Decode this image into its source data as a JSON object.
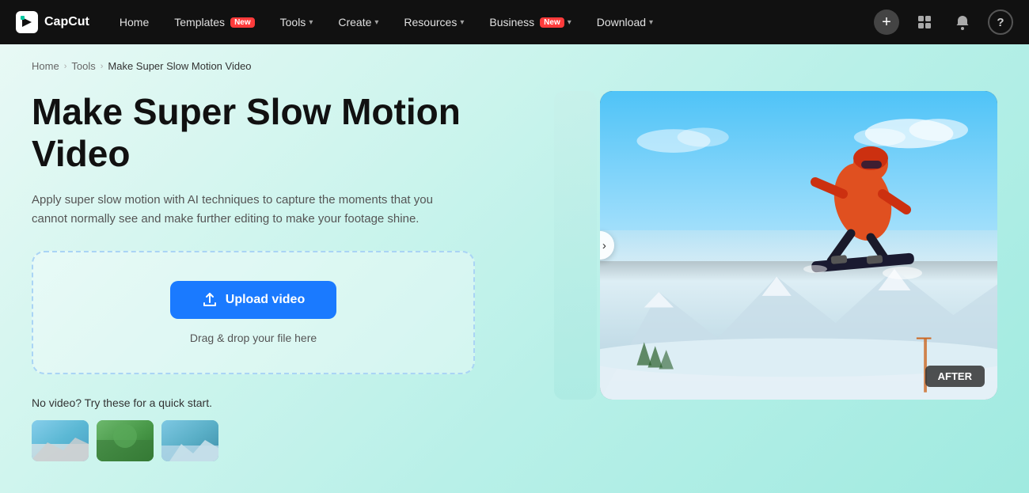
{
  "nav": {
    "logo_text": "CapCut",
    "home_label": "Home",
    "templates_label": "Templates",
    "templates_badge": "New",
    "tools_label": "Tools",
    "create_label": "Create",
    "resources_label": "Resources",
    "business_label": "Business",
    "business_badge": "New",
    "download_label": "Download",
    "plus_icon": "+",
    "dashboard_icon": "⊞",
    "bell_icon": "🔔",
    "help_icon": "?"
  },
  "breadcrumb": {
    "home": "Home",
    "tools": "Tools",
    "current": "Make Super Slow Motion Video"
  },
  "hero": {
    "title": "Make Super Slow Motion Video",
    "description": "Apply super slow motion with AI techniques to capture the moments that you cannot normally see and make further editing to make your footage shine.",
    "upload_btn": "Upload video",
    "drag_hint": "Drag & drop your file here",
    "quick_start_label": "No video? Try these for a quick start."
  },
  "preview": {
    "after_badge": "AFTER",
    "nav_arrow": "‹ ›"
  },
  "icons": {
    "upload": "⬆",
    "chevron_down": "▾",
    "chevron_right": "›"
  }
}
